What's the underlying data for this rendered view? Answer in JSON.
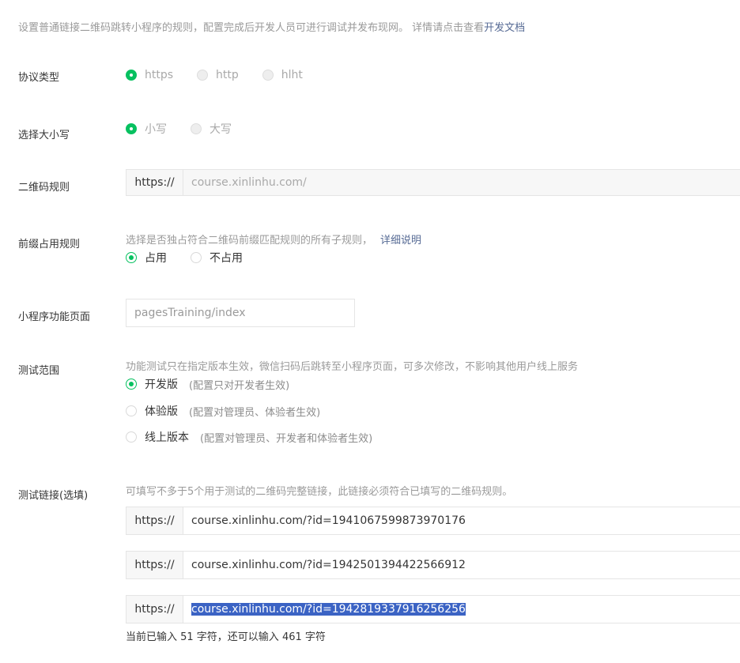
{
  "intro": {
    "text": "设置普通链接二维码跳转小程序的规则，配置完成后开发人员可进行调试并发布现网。 详情请点击查看",
    "link": "开发文档"
  },
  "protocol": {
    "label": "协议类型",
    "options": [
      "https",
      "http",
      "hlht"
    ],
    "selected": "https"
  },
  "case": {
    "label": "选择大小写",
    "options": [
      "小写",
      "大写"
    ],
    "selected": "小写"
  },
  "qr_rule": {
    "label": "二维码规则",
    "prefix": "https://",
    "value": "course.xinlinhu.com/"
  },
  "prefix_rule": {
    "label": "前缀占用规则",
    "hint": "选择是否独占符合二维码前缀匹配规则的所有子规则，",
    "hint_link": "详细说明",
    "options": [
      "占用",
      "不占用"
    ],
    "selected": "占用"
  },
  "page": {
    "label": "小程序功能页面",
    "value": "pagesTraining/index"
  },
  "test_scope": {
    "label": "测试范围",
    "hint": "功能测试只在指定版本生效，微信扫码后跳转至小程序页面，可多次修改，不影响其他用户线上服务",
    "options": [
      {
        "label": "开发版",
        "note": "(配置只对开发者生效)"
      },
      {
        "label": "体验版",
        "note": "(配置对管理员、体验者生效)"
      },
      {
        "label": "线上版本",
        "note": "(配置对管理员、开发者和体验者生效)"
      }
    ],
    "selected": "开发版"
  },
  "test_links": {
    "label": "测试链接(选填)",
    "hint": "可填写不多于5个用于测试的二维码完整链接，此链接必须符合已填写的二维码规则。",
    "links": [
      {
        "prefix": "https://",
        "value": "course.xinlinhu.com/?id=1941067599873970176"
      },
      {
        "prefix": "https://",
        "value": "course.xinlinhu.com/?id=1942501394422566912"
      },
      {
        "prefix": "https://",
        "value": "course.xinlinhu.com/?id=1942819337916256256"
      }
    ],
    "counter": "当前已输入 51 字符，还可以输入 461 字符"
  },
  "colors": {
    "accent": "#07c160",
    "link": "#576b95",
    "selection": "#3b63c4"
  }
}
